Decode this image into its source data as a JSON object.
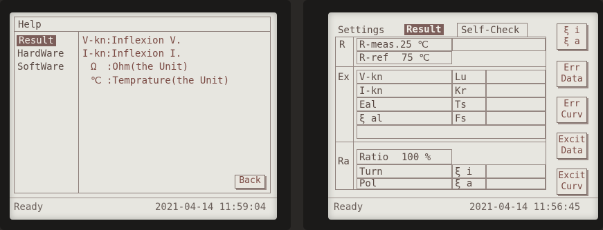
{
  "left_screen": {
    "title": "Help",
    "nav": [
      {
        "label": "Result",
        "selected": true
      },
      {
        "label": "HardWare",
        "selected": false
      },
      {
        "label": "SoftWare",
        "selected": false
      }
    ],
    "help_lines": [
      {
        "text": "V-kn:Inflexion V."
      },
      {
        "text": "I-kn:Inflexion I."
      },
      {
        "symbol": "Ω",
        "text": ":Ohm(the Unit)"
      },
      {
        "symbol": "℃",
        "text": ":Temprature(the Unit)"
      }
    ],
    "back_label": "Back",
    "status_left": "Ready",
    "status_time": "2021-04-14 11:59:04"
  },
  "right_screen": {
    "tabs": [
      {
        "label": "Settings",
        "active": false
      },
      {
        "label": "Result",
        "active": true
      },
      {
        "label": "Self-Check",
        "active": false
      }
    ],
    "groups": {
      "r": "R",
      "ex": "Ex",
      "ra": "Ra"
    },
    "rows": {
      "r_meas_label": "R-meas.25 ℃",
      "r_ref_label": "R-ref",
      "r_ref_value": "75 ℃",
      "vkn": "V-kn",
      "lu": "Lu",
      "ikn": "I-kn",
      "kr": "Kr",
      "eal": "Eal",
      "ts": "Ts",
      "xi_al": "ξ al",
      "fs": "Fs",
      "ratio_label": "Ratio",
      "ratio_value": "100 %",
      "turn": "Turn",
      "xi_i": "ξ i",
      "pol": "Pol",
      "xi_a": "ξ a"
    },
    "side_buttons": [
      {
        "line1": "ξ i",
        "line2": "ξ a"
      },
      {
        "line1": "Err",
        "line2": "Data"
      },
      {
        "line1": "Err",
        "line2": "Curv"
      },
      {
        "line1": "Excit",
        "line2": "Data"
      },
      {
        "line1": "Excit",
        "line2": "Curv"
      }
    ],
    "status_left": "Ready",
    "status_time": "2021-04-14 11:56:45"
  }
}
